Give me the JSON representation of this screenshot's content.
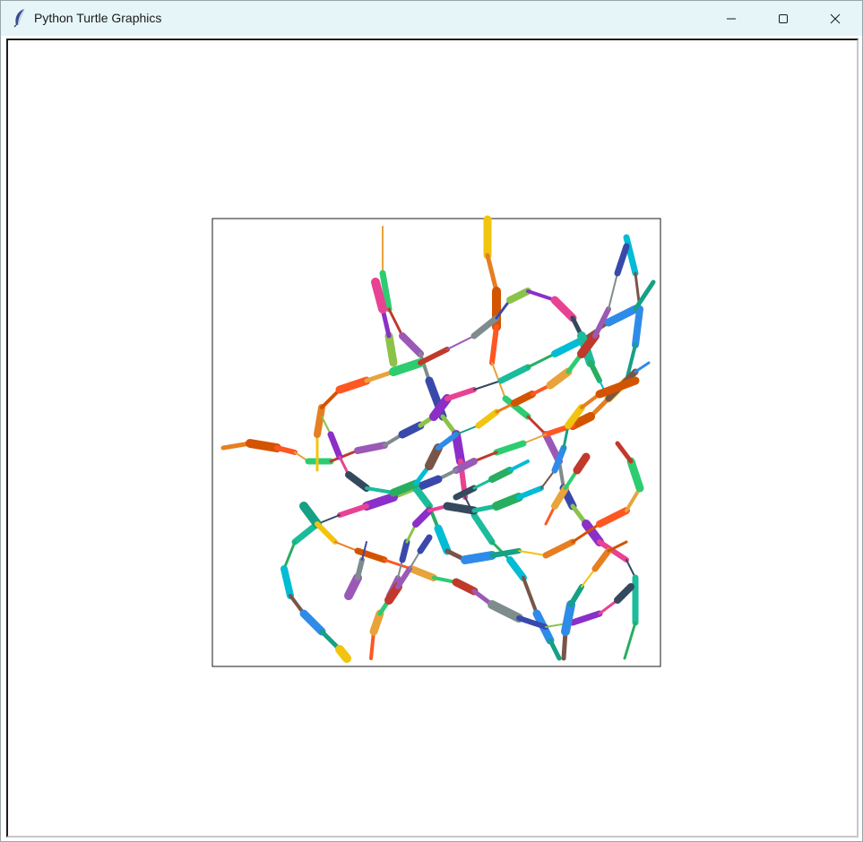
{
  "window": {
    "title": "Python Turtle Graphics",
    "app_icon": "feather-icon",
    "controls": {
      "minimize": "minimize-icon",
      "maximize": "maximize-icon",
      "close": "close-icon"
    }
  },
  "canvas": {
    "background": "#ffffff",
    "drawing": "tangled multicolored path network inside a square frame",
    "stroke_palette": [
      "#e8a33a",
      "#8b2fc9",
      "#2f8be8",
      "#2ecc71",
      "#e84393",
      "#16a085",
      "#c0392b",
      "#34495e",
      "#f1c40f",
      "#9b59b6",
      "#1abc9c",
      "#e67e22",
      "#7f8c8d",
      "#27ae60",
      "#d35400",
      "#3949ab",
      "#00bcd4",
      "#ff5722",
      "#8bc34a",
      "#795548"
    ]
  }
}
